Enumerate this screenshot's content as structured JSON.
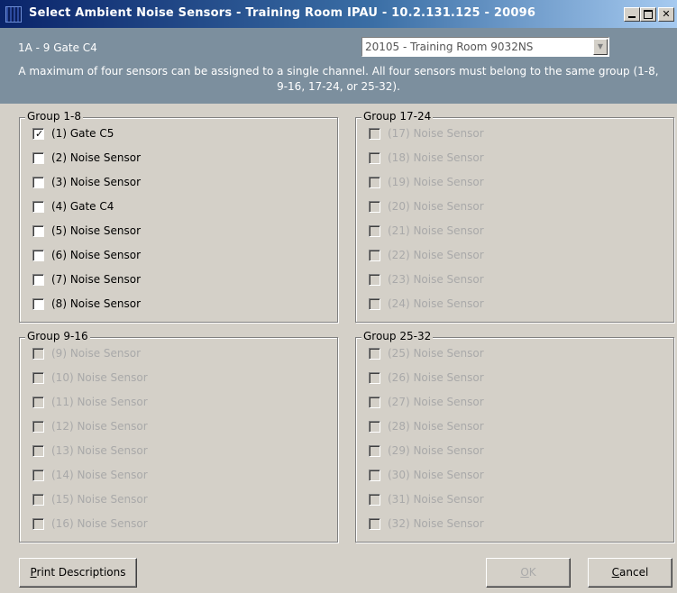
{
  "window": {
    "title": "Select Ambient Noise Sensors - Training Room IPAU - 10.2.131.125 - 20096",
    "icon": "app-icon",
    "controls": [
      "minimize-icon",
      "maximize-icon",
      "close-icon"
    ]
  },
  "header": {
    "channel_label": "1A - 9 Gate C4",
    "zone_select_value": "20105 - Training Room 9032NS",
    "note": "A maximum of four sensors can be assigned to a single channel.  All four sensors must belong to the same group (1-8, 9-16, 17-24, or 25-32)."
  },
  "groups": [
    {
      "legend": "Group 1-8",
      "enabled": true,
      "sensors": [
        {
          "label": "(1) Gate C5",
          "checked": true
        },
        {
          "label": "(2) Noise Sensor",
          "checked": false
        },
        {
          "label": "(3) Noise Sensor",
          "checked": false
        },
        {
          "label": "(4) Gate C4",
          "checked": false
        },
        {
          "label": "(5) Noise Sensor",
          "checked": false
        },
        {
          "label": "(6) Noise Sensor",
          "checked": false
        },
        {
          "label": "(7) Noise Sensor",
          "checked": false
        },
        {
          "label": "(8) Noise Sensor",
          "checked": false
        }
      ]
    },
    {
      "legend": "Group 17-24",
      "enabled": false,
      "sensors": [
        {
          "label": "(17) Noise Sensor",
          "checked": false
        },
        {
          "label": "(18) Noise Sensor",
          "checked": false
        },
        {
          "label": "(19) Noise Sensor",
          "checked": false
        },
        {
          "label": "(20) Noise Sensor",
          "checked": false
        },
        {
          "label": "(21) Noise Sensor",
          "checked": false
        },
        {
          "label": "(22) Noise Sensor",
          "checked": false
        },
        {
          "label": "(23) Noise Sensor",
          "checked": false
        },
        {
          "label": "(24) Noise Sensor",
          "checked": false
        }
      ]
    },
    {
      "legend": "Group 9-16",
      "enabled": false,
      "sensors": [
        {
          "label": "(9) Noise Sensor",
          "checked": false
        },
        {
          "label": "(10) Noise Sensor",
          "checked": false
        },
        {
          "label": "(11) Noise Sensor",
          "checked": false
        },
        {
          "label": "(12) Noise Sensor",
          "checked": false
        },
        {
          "label": "(13) Noise Sensor",
          "checked": false
        },
        {
          "label": "(14) Noise Sensor",
          "checked": false
        },
        {
          "label": "(15) Noise Sensor",
          "checked": false
        },
        {
          "label": "(16) Noise Sensor",
          "checked": false
        }
      ]
    },
    {
      "legend": "Group 25-32",
      "enabled": false,
      "sensors": [
        {
          "label": "(25) Noise Sensor",
          "checked": false
        },
        {
          "label": "(26) Noise Sensor",
          "checked": false
        },
        {
          "label": "(27) Noise Sensor",
          "checked": false
        },
        {
          "label": "(28) Noise Sensor",
          "checked": false
        },
        {
          "label": "(29) Noise Sensor",
          "checked": false
        },
        {
          "label": "(30) Noise Sensor",
          "checked": false
        },
        {
          "label": "(31) Noise Sensor",
          "checked": false
        },
        {
          "label": "(32) Noise Sensor",
          "checked": false
        }
      ]
    }
  ],
  "buttons": {
    "print_descriptions": {
      "mnemonic": "P",
      "rest": "rint Descriptions"
    },
    "ok": {
      "mnemonic": "O",
      "rest": "K",
      "enabled": false
    },
    "cancel": {
      "mnemonic": "C",
      "rest": "ancel"
    }
  },
  "colors": {
    "header_bg": "#7c8f9e",
    "title_gradient_start": "#0a246a",
    "face": "#d4d0c8",
    "disabled_text": "#a9a9a9"
  }
}
